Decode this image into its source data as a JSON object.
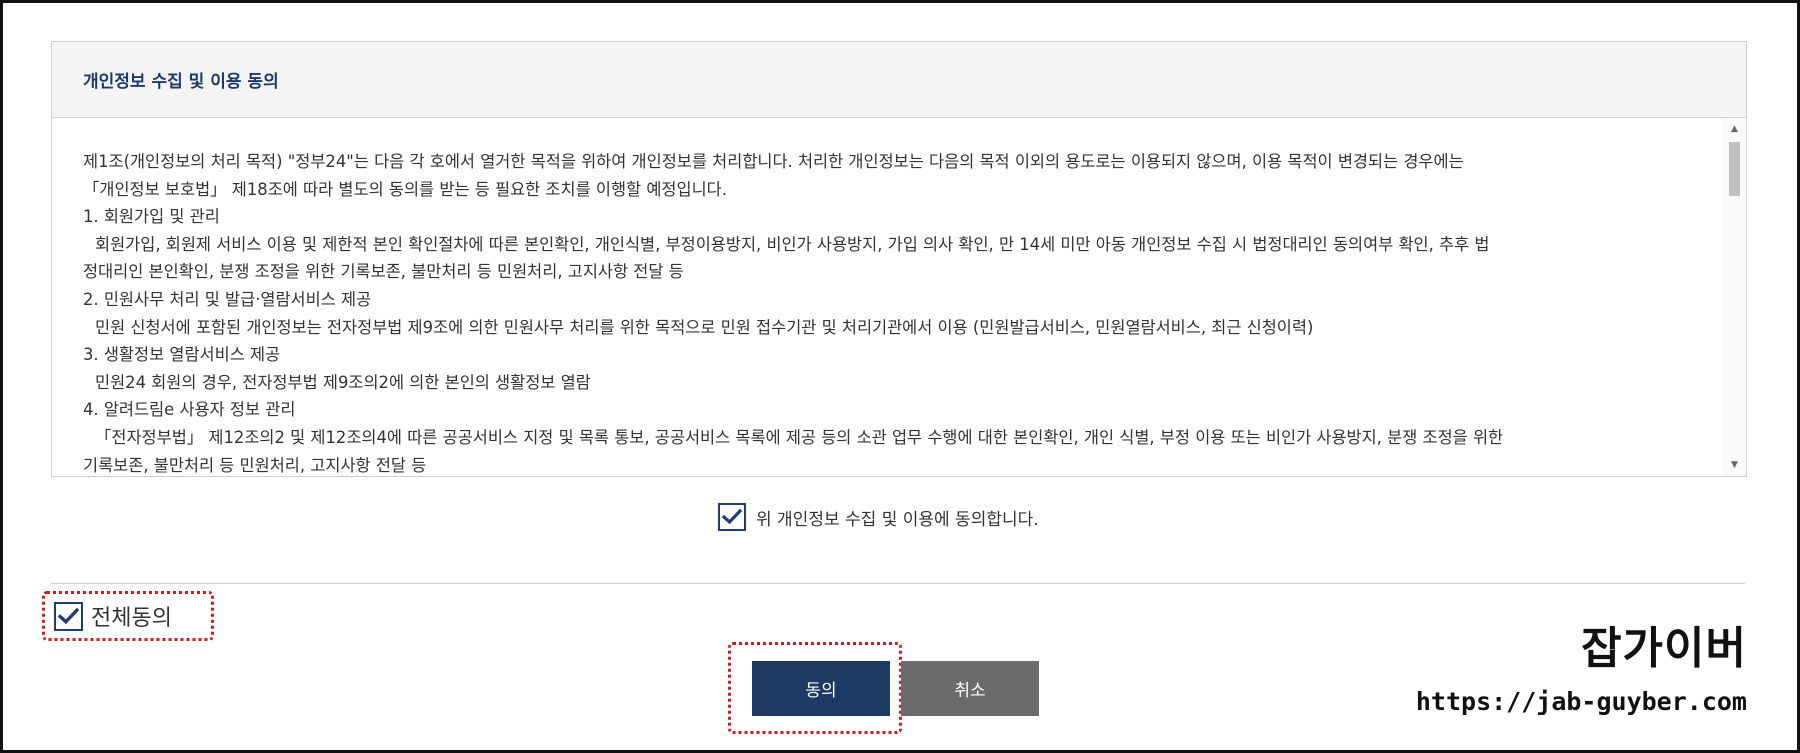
{
  "panel": {
    "title": "개인정보 수집 및 이용 동의",
    "paragraphs": [
      {
        "text": "제1조(개인정보의 처리 목적) \"정부24\"는 다음 각 호에서 열거한 목적을 위하여 개인정보를 처리합니다. 처리한 개인정보는 다음의 목적 이외의 용도로는 이용되지 않으며, 이용 목적이 변경되는 경우에는",
        "indent": false
      },
      {
        "text": "「개인정보 보호법」 제18조에 따라 별도의 동의를 받는 등 필요한 조치를 이행할 예정입니다.",
        "indent": false
      },
      {
        "text": "1. 회원가입 및 관리",
        "indent": false
      },
      {
        "text": "회원가입, 회원제 서비스 이용 및 제한적 본인 확인절차에 따른 본인확인, 개인식별, 부정이용방지, 비인가 사용방지, 가입 의사 확인, 만 14세 미만 아동 개인정보 수집 시 법정대리인 동의여부 확인, 추후 법",
        "indent": true
      },
      {
        "text": "정대리인 본인확인, 분쟁 조정을 위한 기록보존, 불만처리 등 민원처리, 고지사항 전달 등",
        "indent": false
      },
      {
        "text": "2. 민원사무 처리 및 발급·열람서비스 제공",
        "indent": false
      },
      {
        "text": "민원 신청서에 포함된 개인정보는 전자정부법 제9조에 의한 민원사무 처리를 위한 목적으로 민원 접수기관 및 처리기관에서 이용 (민원발급서비스, 민원열람서비스, 최근 신청이력)",
        "indent": true
      },
      {
        "text": "3. 생활정보 열람서비스 제공",
        "indent": false
      },
      {
        "text": "민원24 회원의 경우, 전자정부법 제9조의2에 의한 본인의 생활정보 열람",
        "indent": true
      },
      {
        "text": "4. 알려드림e 사용자 정보 관리",
        "indent": false
      },
      {
        "text": "「전자정부법」 제12조의2 및 제12조의4에 따른 공공서비스 지정 및 목록 통보, 공공서비스 목록에 제공 등의 소관 업무 수행에 대한 본인확인, 개인 식별, 부정 이용 또는 비인가 사용방지, 분쟁 조정을 위한",
        "indent": true
      },
      {
        "text": "기록보존, 불만처리 등 민원처리, 고지사항 전달 등",
        "indent": false
      }
    ]
  },
  "agree_checkbox": {
    "label": "위 개인정보 수집 및 이용에 동의합니다.",
    "checked": true
  },
  "agree_all": {
    "label": "전체동의",
    "checked": true
  },
  "buttons": {
    "agree": "동의",
    "cancel": "취소"
  },
  "watermark": {
    "brand": "잡가이버",
    "url": "https://jab-guyber.com"
  },
  "colors": {
    "accent": "#1c3a64",
    "cancel": "#6b6b6b",
    "highlight": "#c81f1f",
    "title": "#1d3a6b"
  }
}
